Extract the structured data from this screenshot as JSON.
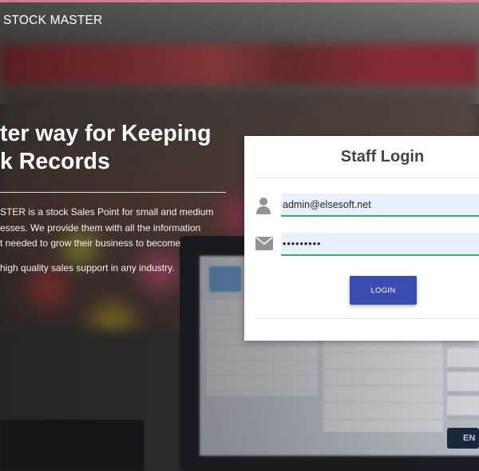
{
  "app": {
    "brand": "STOCK MASTER"
  },
  "hero": {
    "headline_line1": "ter way for Keeping",
    "headline_line2": "k Records",
    "description_line1": "STER is a stock Sales Point for small and medium",
    "description_line2": "esses. We provide them with all the information",
    "description_line3": "t needed to grow their business to become",
    "description_line4": "high quality sales support in any industry."
  },
  "login": {
    "title": "Staff Login",
    "email_value": "admin@elsesoft.net",
    "password_value": "•••••••••",
    "button_label": "LOGIN"
  },
  "background": {
    "screen_button_text": "EN"
  },
  "icons": {
    "user": "user-icon",
    "email": "envelope-icon"
  },
  "colors": {
    "accent_button": "#3b4cb0",
    "input_underline": "#2ab760",
    "input_fill": "#e8f0fe",
    "top_line": "#d9788e"
  }
}
